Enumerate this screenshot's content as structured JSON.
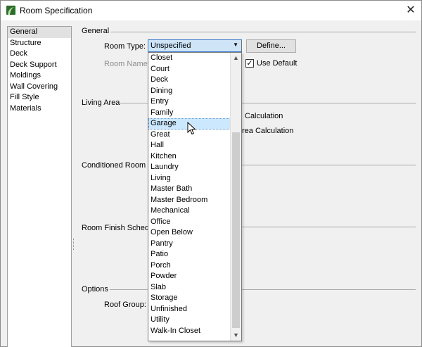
{
  "window": {
    "title": "Room Specification",
    "close_glyph": "✕",
    "app_icon": "chief-architect-icon"
  },
  "sidebar": {
    "items": [
      {
        "label": "General",
        "selected": true
      },
      {
        "label": "Structure"
      },
      {
        "label": "Deck"
      },
      {
        "label": "Deck Support"
      },
      {
        "label": "Moldings"
      },
      {
        "label": "Wall Covering"
      },
      {
        "label": "Fill Style"
      },
      {
        "label": "Materials"
      }
    ]
  },
  "general": {
    "section_title": "General",
    "room_type_label": "Room Type:",
    "room_type_value": "Unspecified",
    "room_name_label": "Room Name:",
    "define_button": "Define...",
    "use_default_label": "Use Default",
    "use_default_checked": true,
    "check_glyph": "✓",
    "arrow_glyph": "▼"
  },
  "living_area": {
    "section_title": "Living Area",
    "option1_partial": "Calculation",
    "option2_partial": "rea Calculation"
  },
  "conditioned_room": {
    "section_title": "Conditioned Room"
  },
  "room_finish": {
    "section_title": "Room Finish Schedule"
  },
  "options": {
    "section_title": "Options",
    "roof_group_label": "Roof Group:"
  },
  "dropdown": {
    "hovered": "Garage",
    "items": [
      "Closet",
      "Court",
      "Deck",
      "Dining",
      "Entry",
      "Family",
      "Garage",
      "Great",
      "Hall",
      "Kitchen",
      "Laundry",
      "Living",
      "Master Bath",
      "Master Bedroom",
      "Mechanical",
      "Office",
      "Open Below",
      "Pantry",
      "Patio",
      "Porch",
      "Powder",
      "Slab",
      "Storage",
      "Unfinished",
      "Utility",
      "Walk-In Closet"
    ],
    "scroll_up_glyph": "▲",
    "scroll_down_glyph": "▼"
  }
}
